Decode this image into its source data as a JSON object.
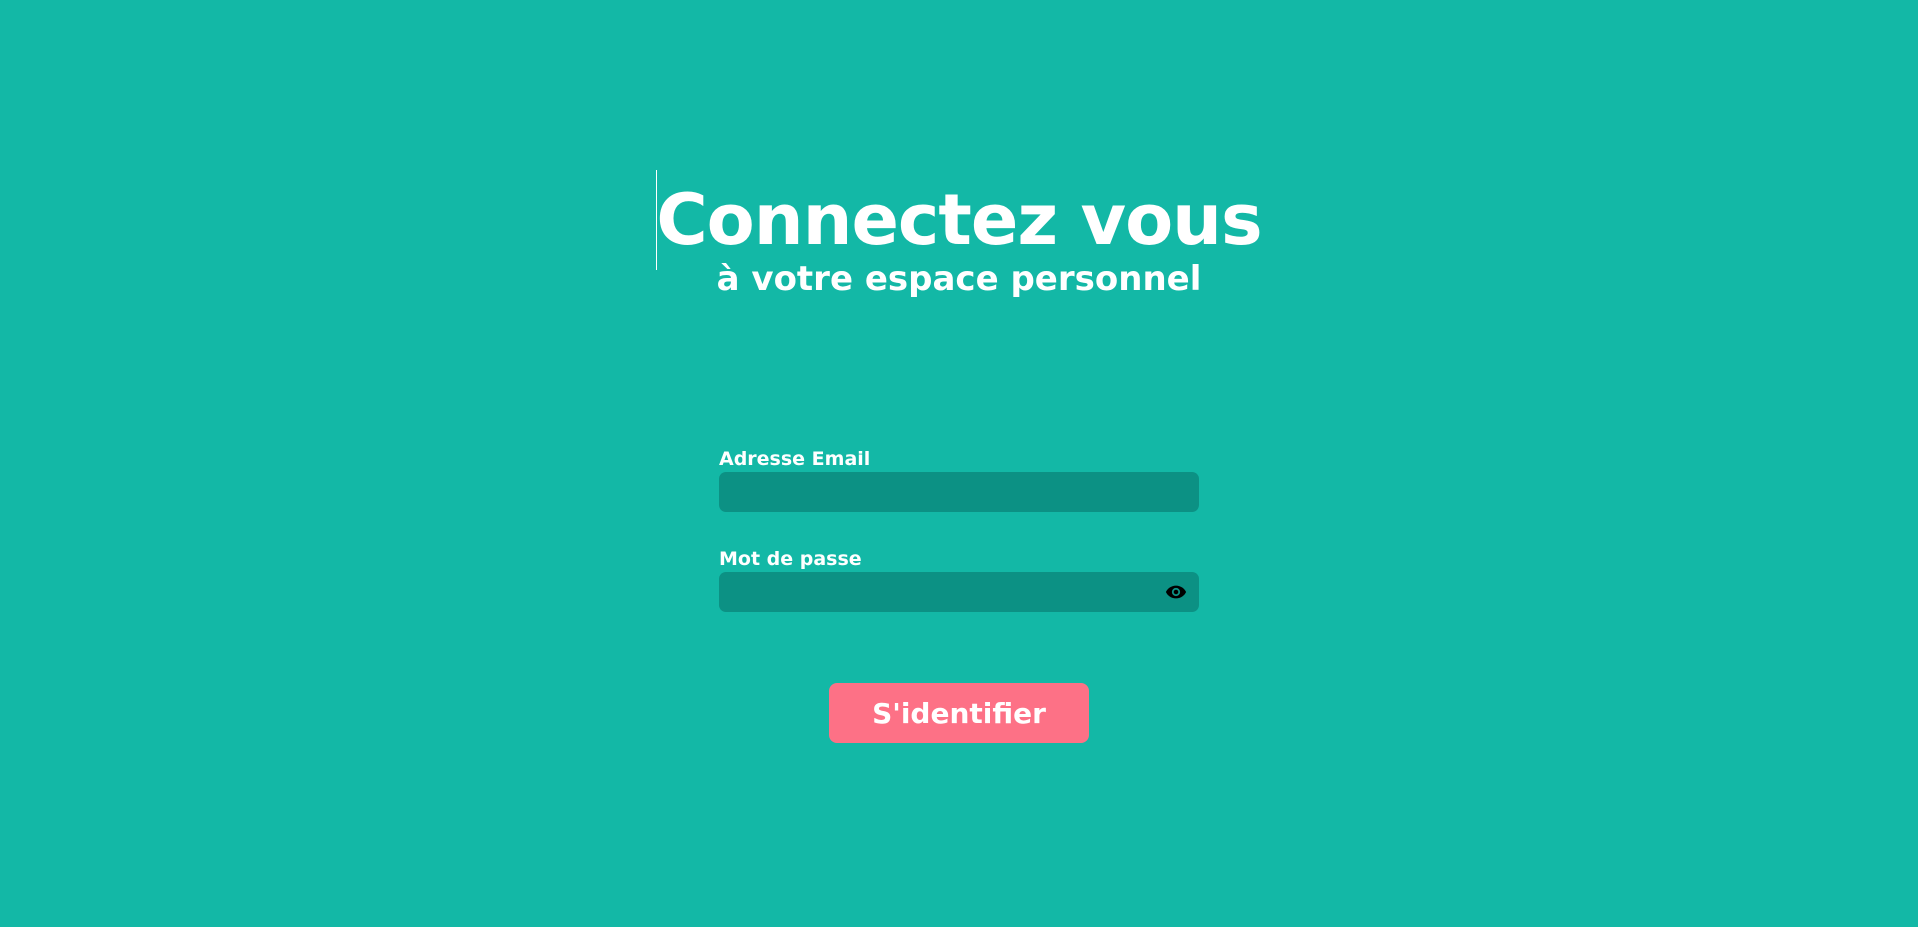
{
  "header": {
    "title": "Connectez vous",
    "subtitle": "à votre espace personnel"
  },
  "form": {
    "email": {
      "label": "Adresse Email",
      "value": ""
    },
    "password": {
      "label": "Mot de passe",
      "value": "",
      "toggle_icon": "eye-icon"
    },
    "submit_label": "S'identifier"
  },
  "colors": {
    "background": "#13b8a6",
    "input_background": "#0c9184",
    "button_background": "#fd7186",
    "text": "#ffffff"
  }
}
